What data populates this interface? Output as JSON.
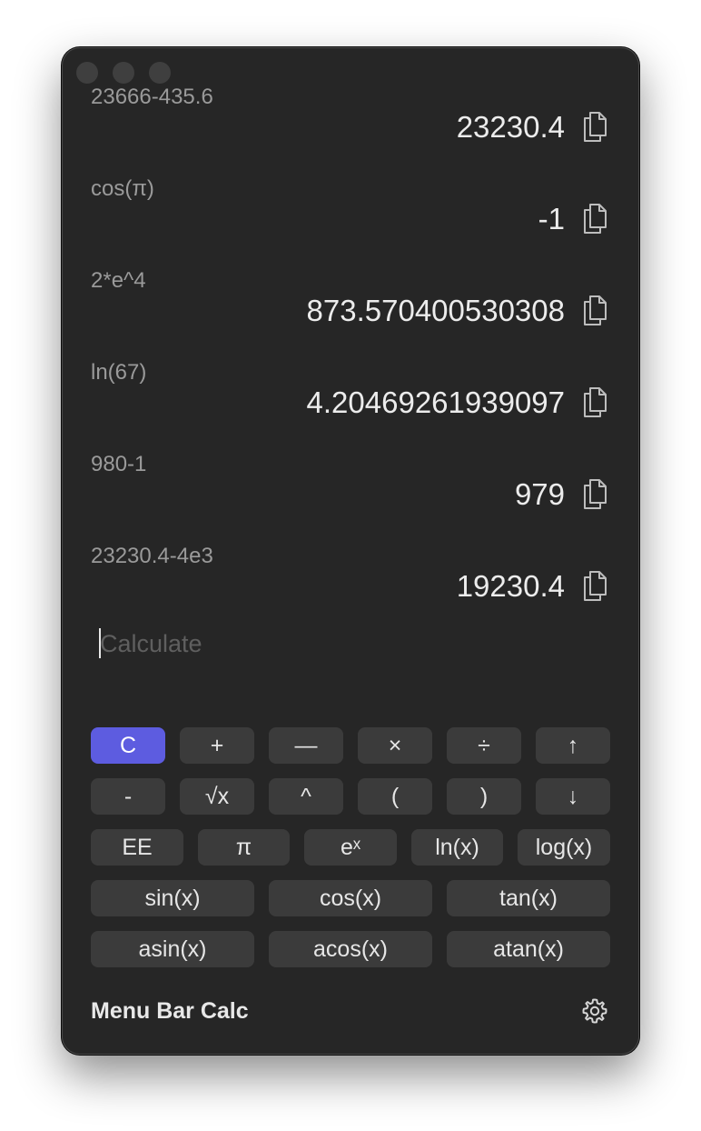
{
  "history": [
    {
      "expression": "23666-435.6",
      "result": "23230.4"
    },
    {
      "expression": "cos(π)",
      "result": "-1"
    },
    {
      "expression": "2*e^4",
      "result": "873.570400530308"
    },
    {
      "expression": "ln(67)",
      "result": "4.20469261939097"
    },
    {
      "expression": "980-1",
      "result": "979"
    },
    {
      "expression": "23230.4-4e3",
      "result": "19230.4"
    }
  ],
  "input": {
    "value": "",
    "placeholder": "Calculate"
  },
  "keypad": {
    "row1": [
      "C",
      "+",
      "—",
      "×",
      "÷",
      "↑"
    ],
    "row2": [
      "-",
      "√x",
      "^",
      "(",
      ")",
      "↓"
    ],
    "row3": [
      "EE",
      "π",
      "eˣ",
      "ln(x)",
      "log(x)"
    ],
    "row4": [
      "sin(x)",
      "cos(x)",
      "tan(x)"
    ],
    "row5": [
      "asin(x)",
      "acos(x)",
      "atan(x)"
    ]
  },
  "footer": {
    "title": "Menu Bar Calc"
  },
  "icons": {
    "copy": "copy-icon",
    "settings": "gear-icon",
    "square_root": "square-root-icon"
  },
  "colors": {
    "accent": "#5d5ce0",
    "window_bg": "#262626",
    "key_bg": "#3b3b3b"
  }
}
